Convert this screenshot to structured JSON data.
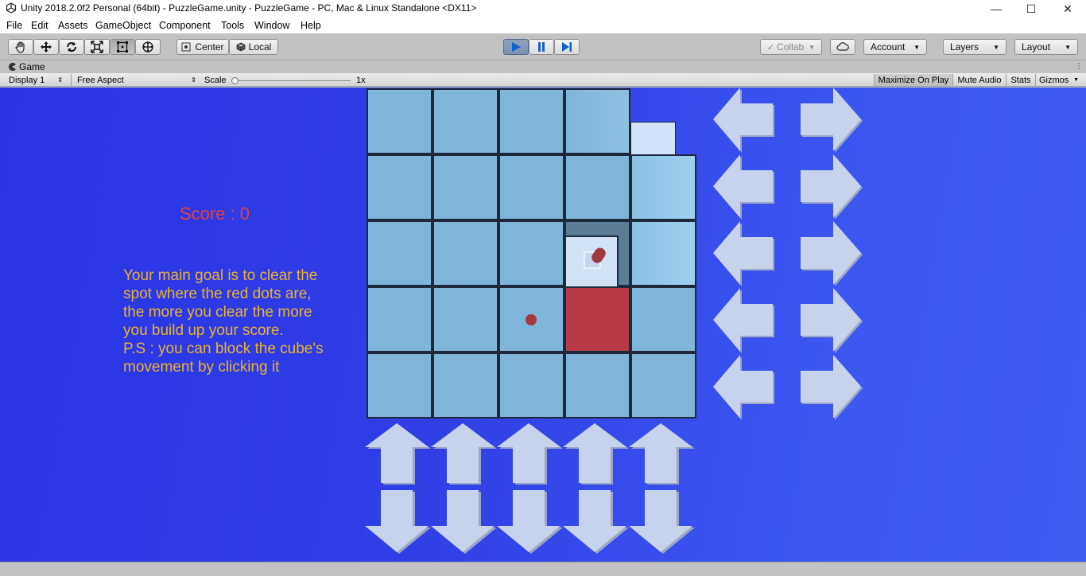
{
  "window": {
    "title": "Unity 2018.2.0f2 Personal (64bit) - PuzzleGame.unity - PuzzleGame - PC, Mac & Linux Standalone <DX11>",
    "minimize_icon": "minimize-icon",
    "maximize_icon": "maximize-icon",
    "close_icon": "close-icon"
  },
  "menu": [
    "File",
    "Edit",
    "Assets",
    "GameObject",
    "Component",
    "Tools",
    "Window",
    "Help"
  ],
  "toolbar": {
    "tools": [
      "hand-tool-icon",
      "move-tool-icon",
      "rotate-tool-icon",
      "scale-tool-icon",
      "rect-tool-icon",
      "transform-tool-icon"
    ],
    "pivot_label": "Center",
    "space_label": "Local",
    "play_icon": "play-icon",
    "pause_icon": "pause-icon",
    "step_icon": "step-icon",
    "collab_label": "Collab",
    "cloud_icon": "cloud-icon",
    "account_label": "Account",
    "layers_label": "Layers",
    "layout_label": "Layout"
  },
  "game_view": {
    "tab_label": "Game",
    "display_label": "Display 1",
    "aspect_label": "Free Aspect",
    "scale_label": "Scale",
    "scale_value": "1x",
    "maximize_label": "Maximize On Play",
    "mute_label": "Mute Audio",
    "stats_label": "Stats",
    "gizmos_label": "Gizmos"
  },
  "game": {
    "score_text": "Score : 0",
    "instructions": [
      "Your main goal is to clear the",
      "spot where the red dots are,",
      "the more you clear the more",
      "you build up your score.",
      "P.S : you can block the cube's",
      "movement by clicking it"
    ],
    "colors": {
      "background": "#3146e8",
      "tile": "#7fb5d8",
      "red_tile": "#b63a48",
      "score": "#e8413a",
      "instructions": "#ecb22e",
      "arrow": "#c7d2ec"
    }
  }
}
